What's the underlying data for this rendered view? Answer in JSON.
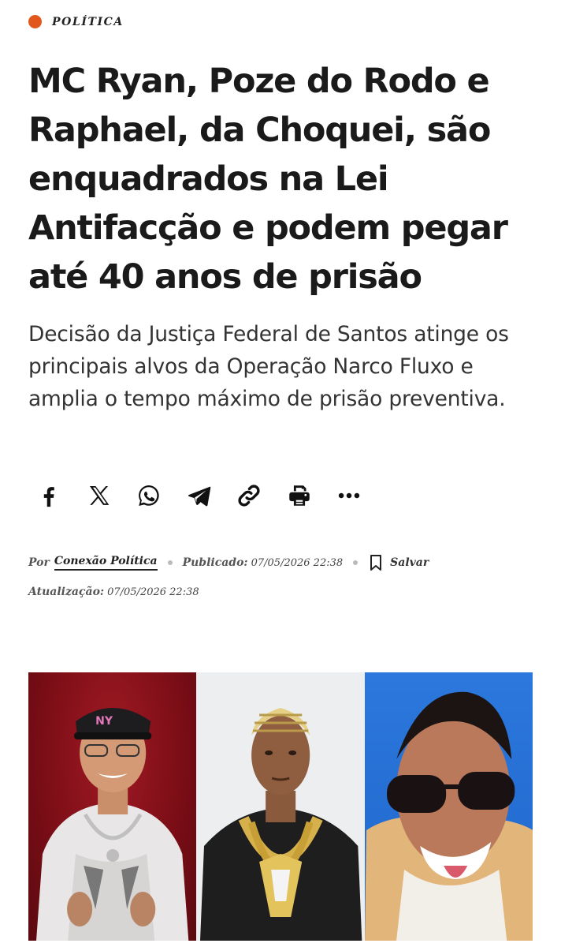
{
  "category": {
    "label": "POLÍTICA",
    "color": "#e2571c"
  },
  "headline": "MC Ryan, Poze do Rodo e Raphael, da Choquei, são enquadrados na Lei Antifacção e podem pegar até 40 anos de prisão",
  "dek": "Decisão da Justiça Federal de Santos atinge os principais alvos da Operação Narco Fluxo e amplia o tempo máximo de prisão preventiva.",
  "share": {
    "icons": [
      "facebook-icon",
      "x-icon",
      "whatsapp-icon",
      "telegram-icon",
      "link-icon",
      "print-icon",
      "more-icon"
    ]
  },
  "meta": {
    "by_label": "Por",
    "author": "Conexão Política",
    "published_label": "Publicado:",
    "published_value": "07/05/2026 22:38",
    "save_label": "Salvar",
    "updated_label": "Atualização:",
    "updated_value": "07/05/2026 22:38"
  },
  "photo": {
    "panels": [
      "mc-ryan-photo",
      "poze-do-rodo-photo",
      "raphael-photo"
    ]
  }
}
